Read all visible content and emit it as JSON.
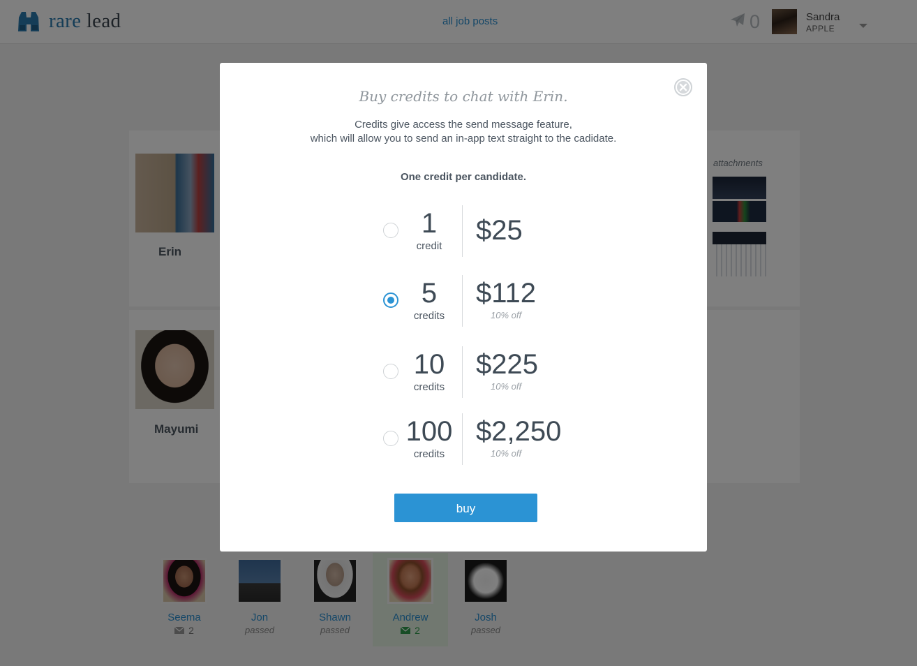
{
  "header": {
    "logo_word_1": "rare",
    "logo_word_2": "lead",
    "nav_all_posts": "all job posts",
    "sent_count": "0",
    "user": {
      "name": "Sandra",
      "company": "APPLE"
    }
  },
  "background": {
    "candidates": [
      {
        "name": "Erin"
      },
      {
        "name": "Mayumi"
      }
    ],
    "attachments_title": "attachments",
    "thumbs": [
      {
        "name": "Seema",
        "messages": "2"
      },
      {
        "name": "Jon",
        "status": "passed"
      },
      {
        "name": "Shawn",
        "status": "passed"
      },
      {
        "name": "Andrew",
        "messages": "2"
      },
      {
        "name": "Josh",
        "status": "passed"
      }
    ]
  },
  "modal": {
    "title": "Buy credits to chat with Erin.",
    "desc_line_1": "Credits give access the send message feature,",
    "desc_line_2": "which will allow you to send an in-app text straight to the cadidate.",
    "note": "One credit per candidate.",
    "options": [
      {
        "qty": "1",
        "unit": "credit",
        "price": "$25",
        "discount": "",
        "selected": false
      },
      {
        "qty": "5",
        "unit": "credits",
        "price": "$112",
        "discount": "10% off",
        "selected": true
      },
      {
        "qty": "10",
        "unit": "credits",
        "price": "$225",
        "discount": "10% off",
        "selected": false
      },
      {
        "qty": "100",
        "unit": "credits",
        "price": "$2,250",
        "discount": "10% off",
        "selected": false
      }
    ],
    "buy_label": "buy"
  },
  "colors": {
    "accent": "#2b93d4",
    "logo_blue": "#2a7aae",
    "active_green": "#2f9b4a"
  },
  "icons": [
    "binoculars-logo-icon",
    "paper-plane-icon",
    "chevron-down-icon",
    "envelope-icon",
    "close-circle-icon"
  ]
}
